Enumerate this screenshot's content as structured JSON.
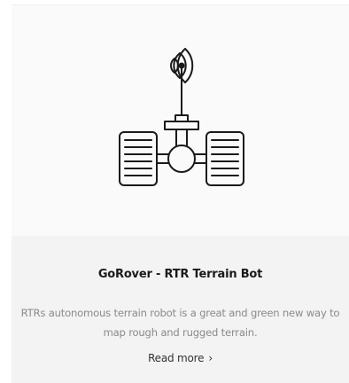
{
  "card": {
    "image_icon": "terrain-rover-robot-icon",
    "title": "GoRover - RTR Terrain Bot",
    "description": "RTRs autonomous terrain robot is a great and green new way to map rough and rugged terrain.",
    "read_more_label": "Read more",
    "read_more_icon": "chevron-right-icon",
    "read_more_glyph": "›"
  },
  "colors": {
    "card_image_bg": "#fafafa",
    "card_body_bg": "#f3f3f3",
    "title": "#1a1a1a",
    "description": "#8a8a8a",
    "icon_stroke": "#1a1a1a"
  }
}
